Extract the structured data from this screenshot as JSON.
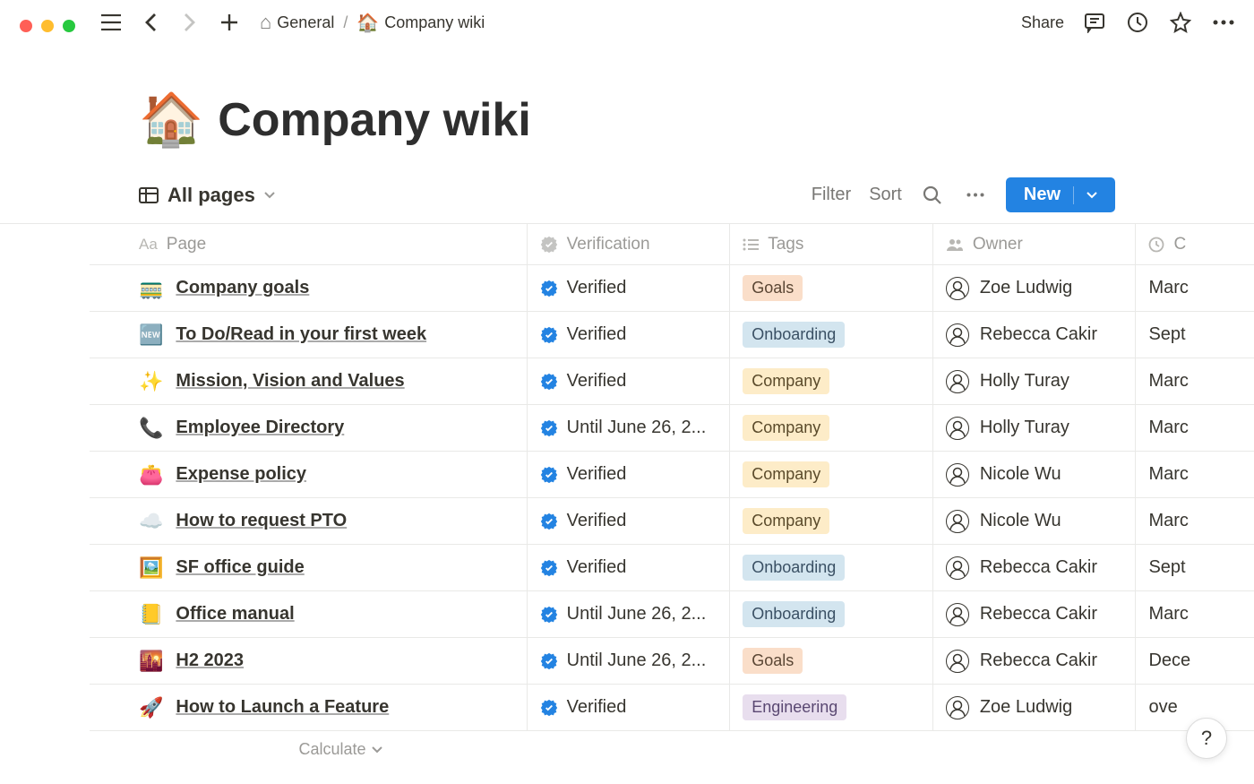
{
  "window": {
    "breadcrumb_parent": "General",
    "breadcrumb_current": "Company wiki",
    "parent_emoji": "⌂",
    "current_emoji": "🏠",
    "share_label": "Share"
  },
  "page": {
    "emoji": "🏠",
    "title": "Company wiki"
  },
  "view": {
    "name": "All pages",
    "filter_label": "Filter",
    "sort_label": "Sort",
    "new_label": "New",
    "calculate_label": "Calculate"
  },
  "columns": {
    "page": "Page",
    "verification": "Verification",
    "tags": "Tags",
    "owner": "Owner",
    "created": "C"
  },
  "rows": [
    {
      "emoji": "🚃",
      "title": "Company goals",
      "verification": "Verified",
      "tag": "Goals",
      "tag_class": "tag-goals",
      "owner": "Zoe Ludwig",
      "created": "Marc"
    },
    {
      "emoji": "🆕",
      "title": "To Do/Read in your first week",
      "verification": "Verified",
      "tag": "Onboarding",
      "tag_class": "tag-onboarding",
      "owner": "Rebecca Cakir",
      "created": "Sept"
    },
    {
      "emoji": "✨",
      "title": "Mission, Vision and Values",
      "verification": "Verified",
      "tag": "Company",
      "tag_class": "tag-company",
      "owner": "Holly Turay",
      "created": "Marc"
    },
    {
      "emoji": "📞",
      "title": "Employee Directory",
      "verification": "Until June 26, 2...",
      "tag": "Company",
      "tag_class": "tag-company",
      "owner": "Holly Turay",
      "created": "Marc"
    },
    {
      "emoji": "👛",
      "title": "Expense policy",
      "verification": "Verified",
      "tag": "Company",
      "tag_class": "tag-company",
      "owner": "Nicole Wu",
      "created": "Marc"
    },
    {
      "emoji": "☁️",
      "title": "How to request PTO",
      "verification": "Verified",
      "tag": "Company",
      "tag_class": "tag-company",
      "owner": "Nicole Wu",
      "created": "Marc"
    },
    {
      "emoji": "🖼️",
      "title": "SF office guide",
      "verification": "Verified",
      "tag": "Onboarding",
      "tag_class": "tag-onboarding",
      "owner": "Rebecca Cakir",
      "created": "Sept"
    },
    {
      "emoji": "📒",
      "title": "Office manual",
      "verification": "Until June 26, 2...",
      "tag": "Onboarding",
      "tag_class": "tag-onboarding",
      "owner": "Rebecca Cakir",
      "created": "Marc"
    },
    {
      "emoji": "🌇",
      "title": "H2 2023",
      "verification": "Until June 26, 2...",
      "tag": "Goals",
      "tag_class": "tag-goals",
      "owner": "Rebecca Cakir",
      "created": "Dece"
    },
    {
      "emoji": "🚀",
      "title": "How to Launch a Feature",
      "verification": "Verified",
      "tag": "Engineering",
      "tag_class": "tag-engineering",
      "owner": "Zoe Ludwig",
      "created": "ove"
    }
  ],
  "help": "?"
}
